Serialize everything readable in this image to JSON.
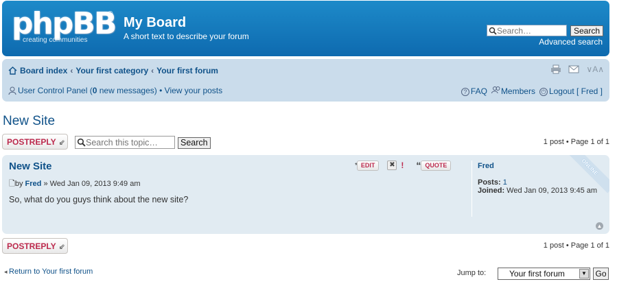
{
  "header": {
    "logo_text": "phpBB",
    "logo_reg": "®",
    "logo_tagline": "creating communities",
    "site_title": "My Board",
    "site_description": "A short text to describe your forum",
    "search_placeholder": "Search…",
    "search_button": "Search",
    "advanced_search": "Advanced search"
  },
  "navbar": {
    "breadcrumbs": [
      "Board index",
      "Your first category",
      "Your first forum"
    ],
    "breadcrumb_sep": "‹",
    "font_resize": "A",
    "ucp_label": "User Control Panel (",
    "new_messages_count": "0",
    "new_messages_suffix": " new messages) • ",
    "view_posts": "View your posts",
    "faq": "FAQ",
    "members": "Members",
    "logout": "Logout [ Fred ]"
  },
  "topic": {
    "title": "New Site",
    "post_reply": "POSTREPLY",
    "search_placeholder": "Search this topic…",
    "search_button": "Search",
    "pagination": "1 post • Page 1 of 1"
  },
  "post": {
    "subject": "New Site",
    "meta_by": "by ",
    "author": "Fred",
    "meta_date": " » Wed Jan 09, 2013 9:49 am",
    "body": "So, what do you guys think about the new site?",
    "btn_edit": "EDIT",
    "btn_quote": "QUOTE",
    "online_badge": "ONLINE",
    "profile_name": "Fred",
    "posts_label": "Posts: ",
    "posts_value": "1",
    "joined_label": "Joined: ",
    "joined_value": "Wed Jan 09, 2013 9:45 am"
  },
  "footer": {
    "return_link": "Return to Your first forum",
    "jump_label": "Jump to:",
    "jump_selected": "Your first forum",
    "go_button": "Go"
  },
  "colors": {
    "header_bg": "#1278bd",
    "navbar_bg": "#cadceb",
    "post_bg": "#e1ebf2",
    "link": "#105289",
    "reply_red": "#bc2a4d"
  }
}
